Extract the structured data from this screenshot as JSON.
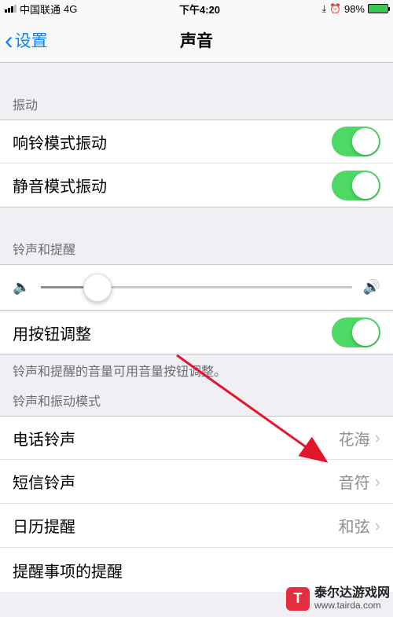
{
  "statusBar": {
    "carrier": "中国联通",
    "network": "4G",
    "time": "下午4:20",
    "batteryPct": "98%"
  },
  "nav": {
    "backLabel": "设置",
    "title": "声音"
  },
  "sections": {
    "vibration": {
      "header": "振动",
      "items": [
        {
          "label": "响铃模式振动",
          "on": true
        },
        {
          "label": "静音模式振动",
          "on": true
        }
      ]
    },
    "ringer": {
      "header": "铃声和提醒",
      "sliderPercent": 18,
      "adjustWithButtons": {
        "label": "用按钮调整",
        "on": true
      },
      "footer": "铃声和提醒的音量可用音量按钮调整。"
    },
    "patterns": {
      "header": "铃声和振动模式",
      "items": [
        {
          "label": "电话铃声",
          "value": "花海"
        },
        {
          "label": "短信铃声",
          "value": "音符"
        },
        {
          "label": "日历提醒",
          "value": "和弦"
        },
        {
          "label": "提醒事项的提醒",
          "value": ""
        }
      ]
    }
  },
  "watermark": {
    "logoLetter": "T",
    "name": "泰尔达游戏网",
    "url": "www.tairda.com"
  }
}
